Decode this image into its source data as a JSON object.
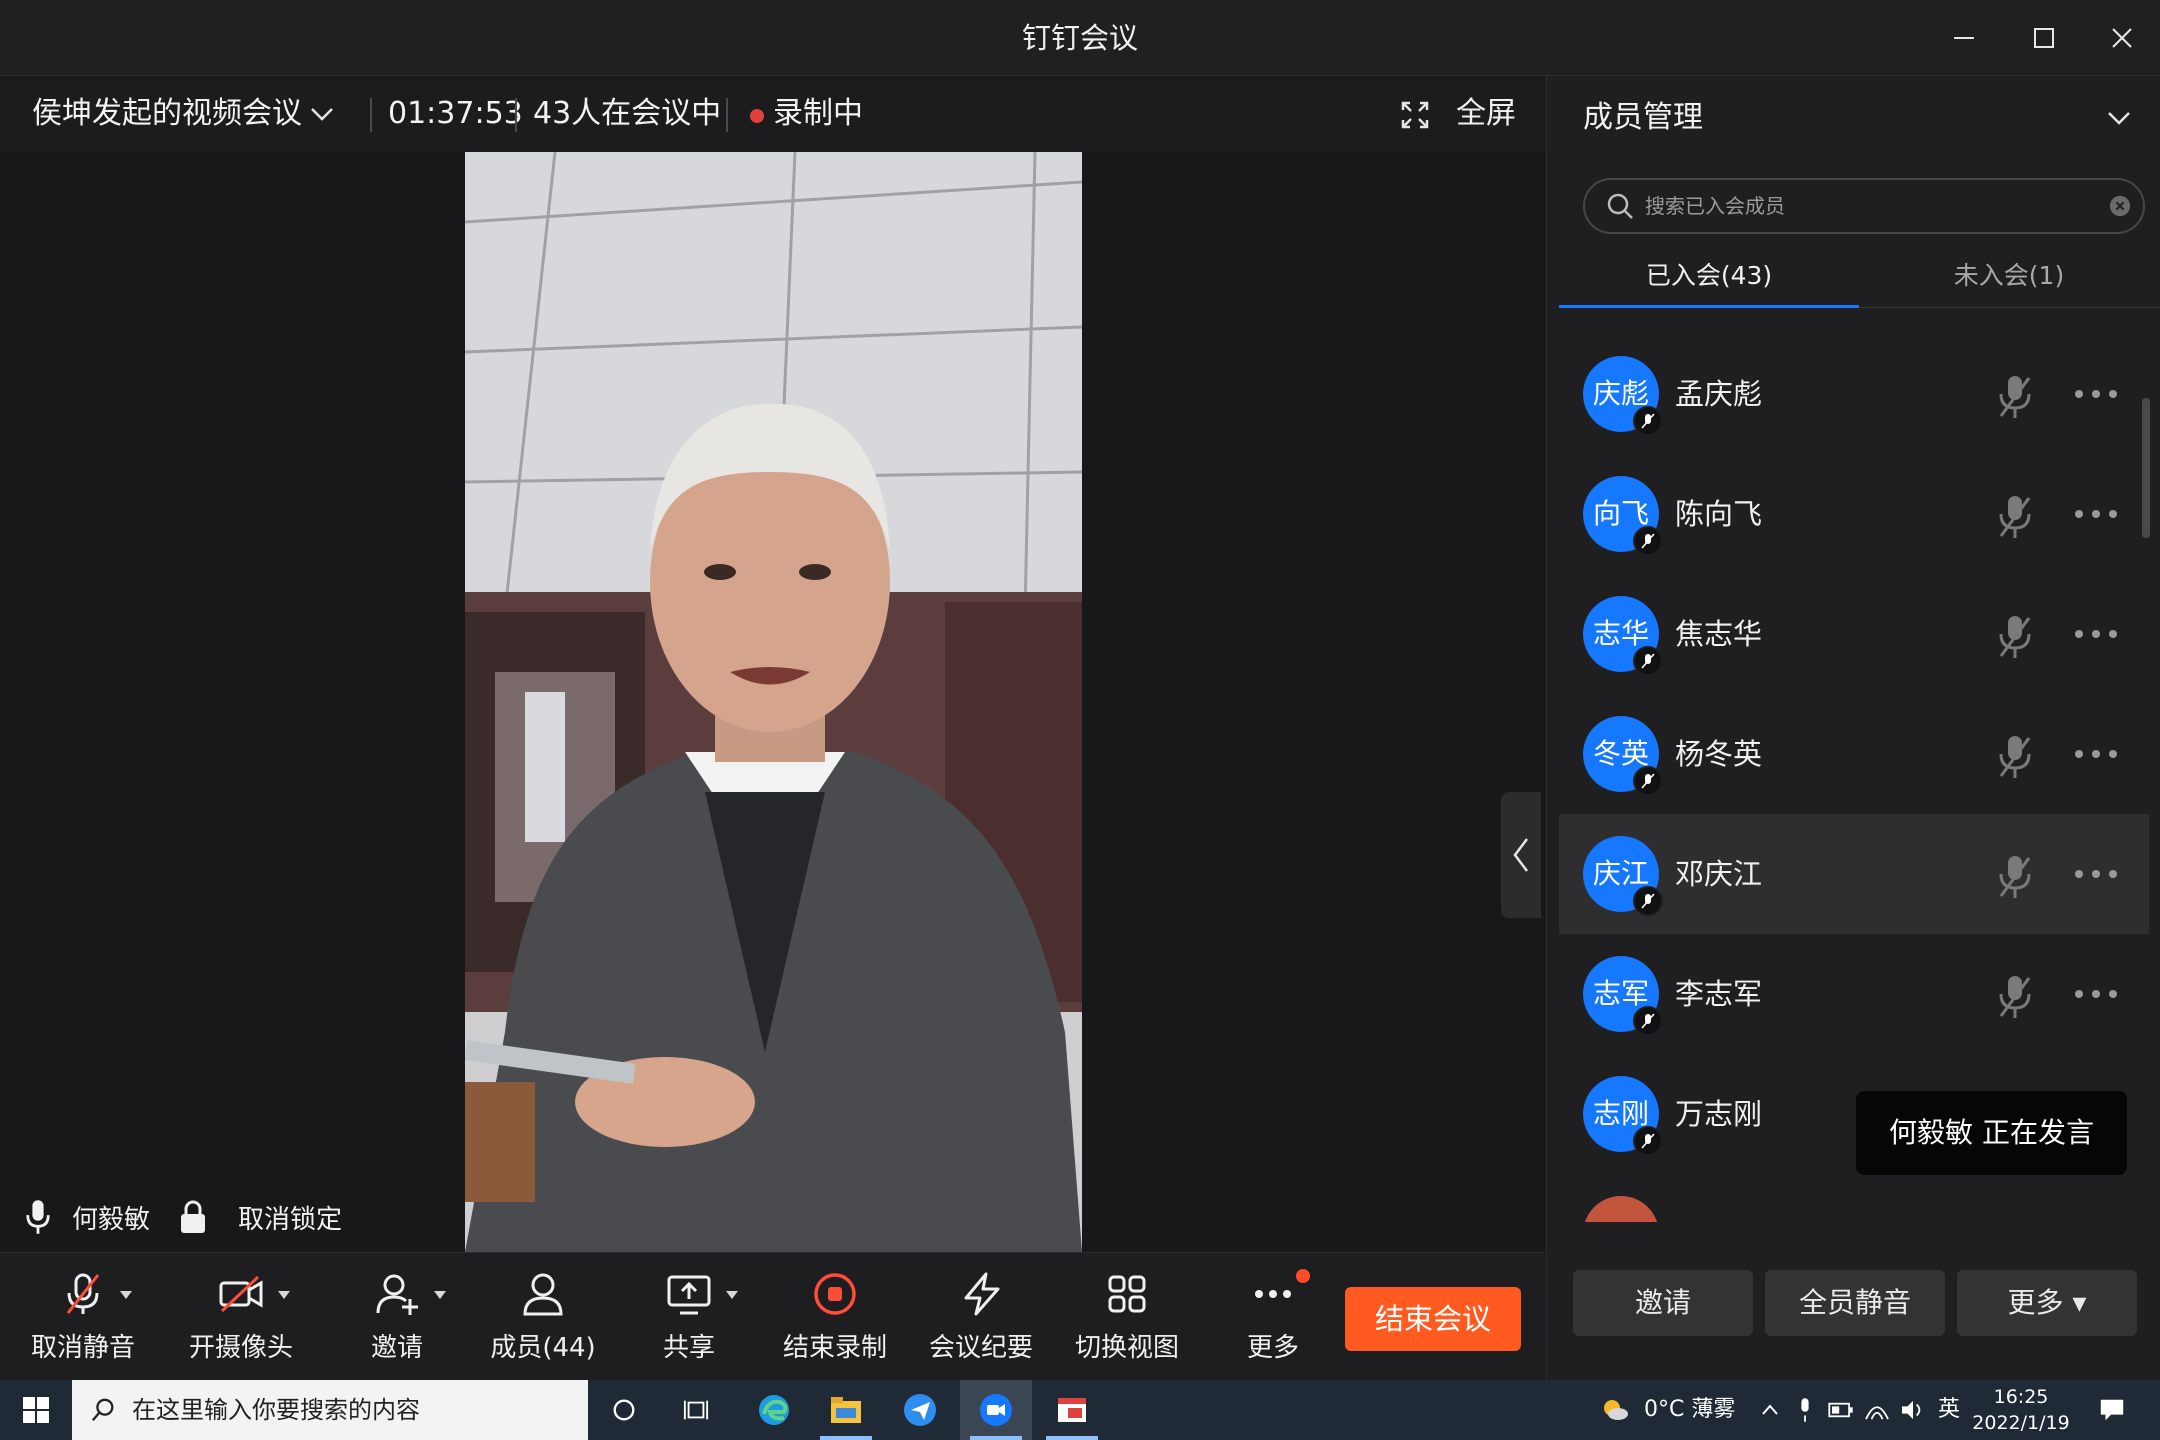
{
  "window": {
    "title": "钉钉会议"
  },
  "meeting": {
    "title": "侯坤发起的视频会议",
    "duration": "01:37:53",
    "participants_text": "43人在会议中",
    "recording_text": "录制中",
    "fullscreen_label": "全屏"
  },
  "video": {
    "speaker_name": "何毅敏",
    "unlock_label": "取消锁定"
  },
  "toolbar": {
    "unmute": "取消静音",
    "camera": "开摄像头",
    "invite": "邀请",
    "members": "成员(44)",
    "share": "共享",
    "stop_record": "结束录制",
    "minutes": "会议纪要",
    "switch_view": "切换视图",
    "more": "更多",
    "end_meeting": "结束会议"
  },
  "panel": {
    "title": "成员管理",
    "search_placeholder": "搜索已入会成员",
    "tabs": [
      "已入会(43)",
      "未入会(1)"
    ],
    "members": [
      {
        "avatar": "庆彪",
        "name": "孟庆彪"
      },
      {
        "avatar": "向飞",
        "name": "陈向飞"
      },
      {
        "avatar": "志华",
        "name": "焦志华"
      },
      {
        "avatar": "冬英",
        "name": "杨冬英"
      },
      {
        "avatar": "庆江",
        "name": "邓庆江"
      },
      {
        "avatar": "志军",
        "name": "李志军"
      },
      {
        "avatar": "志刚",
        "name": "万志刚"
      }
    ],
    "tooltip": "何毅敏  正在发言",
    "buttons": {
      "invite": "邀请",
      "mute_all": "全员静音",
      "more": "更多 ▾"
    }
  },
  "taskbar": {
    "search_placeholder": "在这里输入你要搜索的内容",
    "weather": "0°C  薄雾",
    "ime": "英",
    "time": "16:25",
    "date": "2022/1/19"
  },
  "colors": {
    "accent": "#1677ff",
    "end_button": "#ff5a1f",
    "recording": "#e0423b"
  }
}
